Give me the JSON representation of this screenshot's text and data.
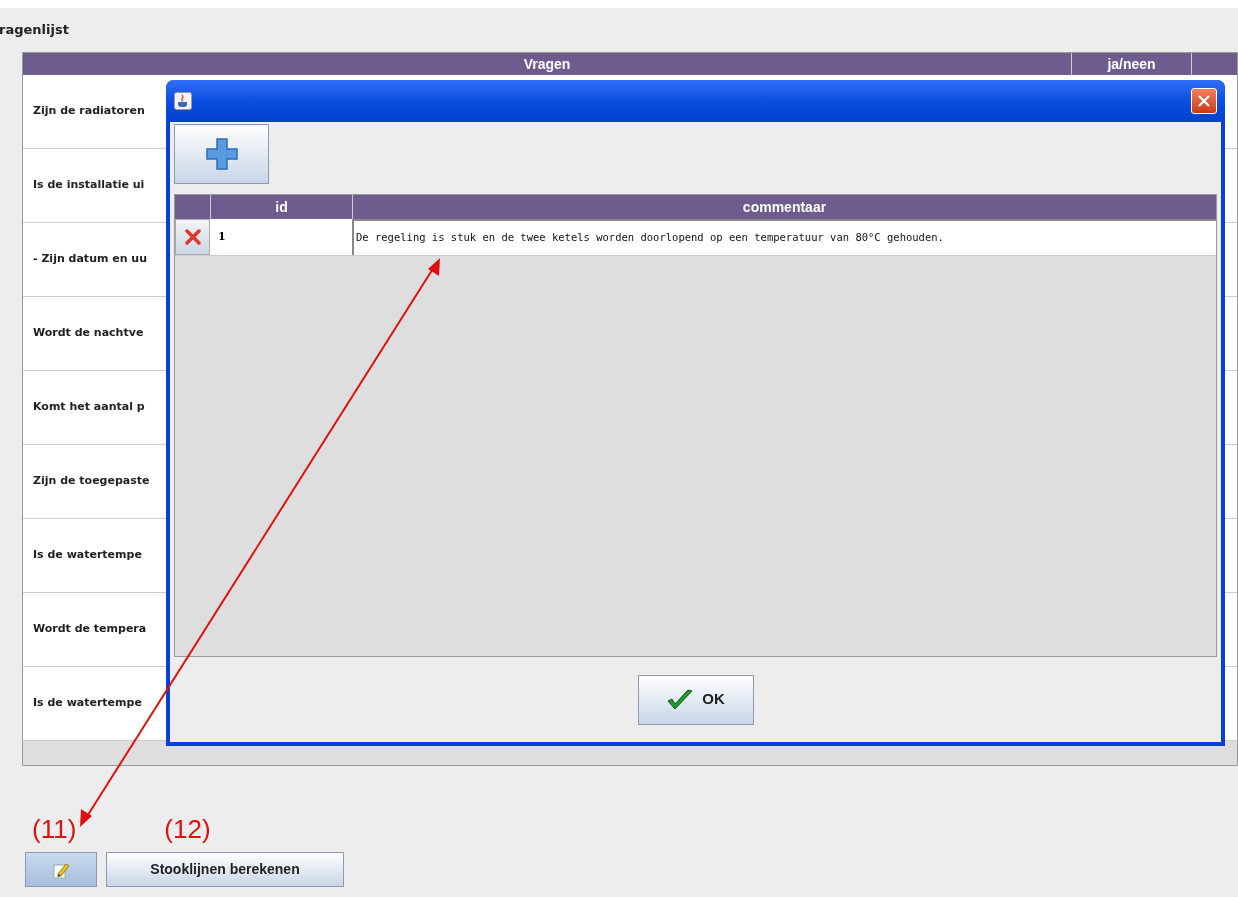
{
  "page": {
    "title": "ragenlijst"
  },
  "table": {
    "columns": [
      "Vragen",
      "ja/neen"
    ],
    "rows": [
      "Zijn de radiatoren",
      "Is de installatie ui",
      "- Zijn datum en uu",
      "Wordt de nachtve",
      "Komt het aantal p",
      "Zijn de toegepaste",
      "Is de watertempe",
      "Wordt de tempera",
      "Is de watertempe"
    ]
  },
  "dialog": {
    "table": {
      "columns": [
        "id",
        "commentaar"
      ],
      "rows": [
        {
          "id": "1",
          "commentaar": "De regeling is stuk en de twee ketels worden doorlopend op een temperatuur van 80°C gehouden."
        }
      ]
    },
    "ok_button": "OK"
  },
  "annotations": [
    {
      "label": "(11)"
    },
    {
      "label": "(12)"
    }
  ],
  "buttons": [
    {
      "kind": "icon"
    },
    {
      "kind": "text",
      "label": "Stooklijnen berekenen"
    }
  ]
}
